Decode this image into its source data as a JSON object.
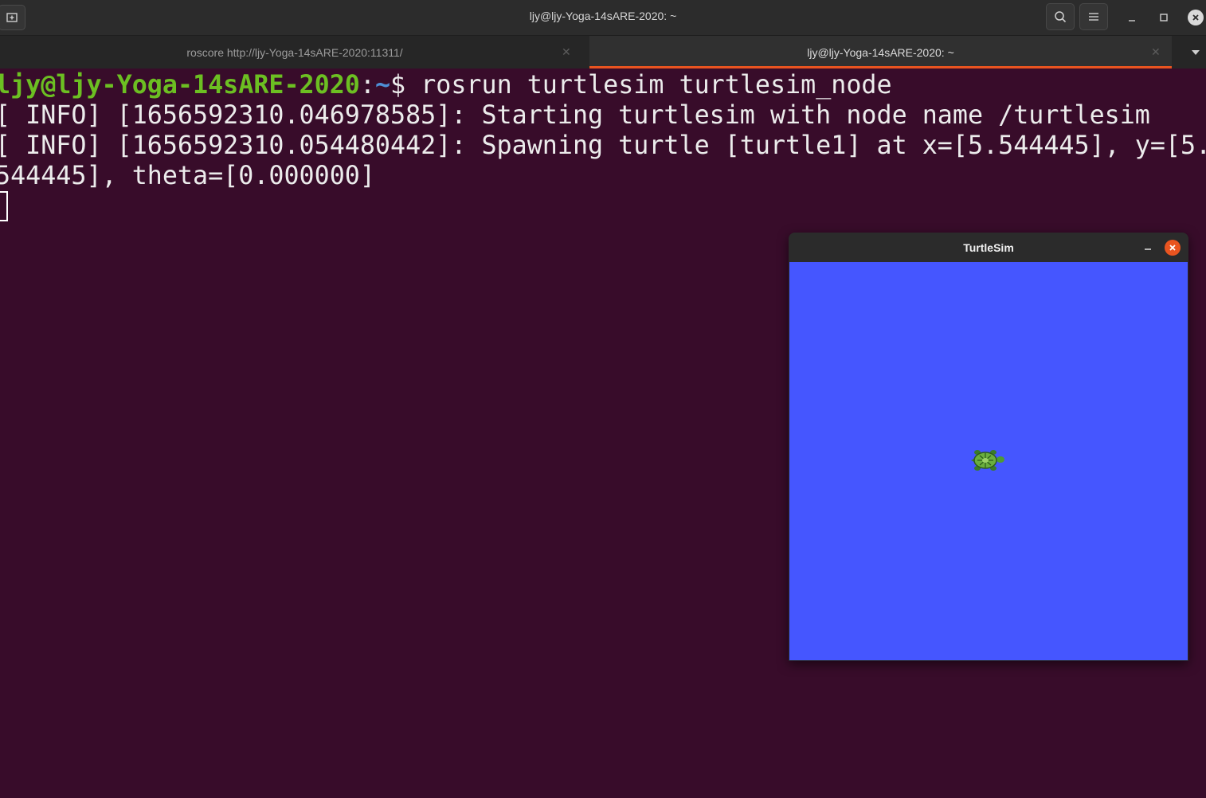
{
  "window": {
    "title": "ljy@ljy-Yoga-14sARE-2020: ~",
    "icons": [
      "new-tab-icon",
      "search-icon",
      "hamburger-menu-icon",
      "minimize-icon",
      "maximize-icon",
      "close-icon"
    ]
  },
  "tabs": [
    {
      "label": "roscore http://ljy-Yoga-14sARE-2020:11311/",
      "active": false
    },
    {
      "label": "ljy@ljy-Yoga-14sARE-2020: ~",
      "active": true
    }
  ],
  "terminal": {
    "prompt_user": "ljy@ljy-Yoga-14sARE-2020",
    "prompt_sep": ":",
    "prompt_path": "~",
    "prompt_dollar": "$ ",
    "command": "rosrun turtlesim turtlesim_node",
    "lines": [
      "[ INFO] [1656592310.046978585]: Starting turtlesim with node name /turtlesim",
      "[ INFO] [1656592310.054480442]: Spawning turtle [turtle1] at x=[5.544445], y=[5.",
      "544445], theta=[0.000000]"
    ]
  },
  "turtlesim": {
    "title": "TurtleSim",
    "background_color": "#4556ff",
    "accent_close_color": "#e95420"
  },
  "colors": {
    "terminal_bg": "#380c2a",
    "prompt_user": "#6cbf22",
    "prompt_path": "#4e8fd6",
    "active_tab_underline": "#e95420"
  }
}
